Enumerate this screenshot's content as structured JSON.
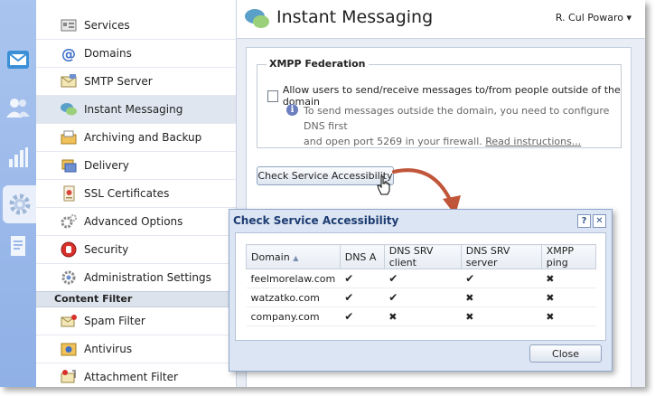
{
  "sidebar": {
    "items": [
      {
        "label": "Services",
        "icon": "services-icon"
      },
      {
        "label": "Domains",
        "icon": "at-sign-icon"
      },
      {
        "label": "SMTP Server",
        "icon": "smtp-envelope-icon"
      },
      {
        "label": "Instant Messaging",
        "icon": "chat-bubbles-icon"
      },
      {
        "label": "Archiving and Backup",
        "icon": "archive-icon"
      },
      {
        "label": "Delivery",
        "icon": "delivery-icon"
      },
      {
        "label": "SSL Certificates",
        "icon": "certificate-icon"
      },
      {
        "label": "Advanced Options",
        "icon": "gears-icon"
      },
      {
        "label": "Security",
        "icon": "stop-hand-icon"
      },
      {
        "label": "Administration Settings",
        "icon": "admin-settings-icon"
      }
    ],
    "group_label": "Content Filter",
    "filter_items": [
      {
        "label": "Spam Filter",
        "icon": "spam-filter-icon"
      },
      {
        "label": "Antivirus",
        "icon": "antivirus-icon"
      },
      {
        "label": "Attachment Filter",
        "icon": "attachment-filter-icon"
      }
    ]
  },
  "header": {
    "title": "Instant Messaging",
    "user": "R. Cul Powaro ▾"
  },
  "xmpp": {
    "legend": "XMPP Federation",
    "checkbox_label": "Allow users to send/receive messages to/from people outside of the domain",
    "checked": false,
    "info_line1": "To send messages outside the domain, you need to configure DNS first",
    "info_line2": "and open port 5269 in your firewall.",
    "info_link": "Read instructions..."
  },
  "check_button": "Check Service Accessibility",
  "dialog": {
    "title": "Check Service Accessibility",
    "help": "?",
    "close_x": "✕",
    "columns": [
      "Domain",
      "DNS A",
      "DNS SRV client",
      "DNS SRV server",
      "XMPP ping"
    ],
    "sort_indicator": "▲",
    "rows": [
      {
        "domain": "feelmorelaw.com",
        "dns_a": "✔",
        "srv_client": "✔",
        "srv_server": "✔",
        "xmpp_ping": "✖"
      },
      {
        "domain": "watzatko.com",
        "dns_a": "✔",
        "srv_client": "✔",
        "srv_server": "✖",
        "xmpp_ping": "✖"
      },
      {
        "domain": "company.com",
        "dns_a": "✔",
        "srv_client": "✖",
        "srv_server": "✖",
        "xmpp_ping": "✖"
      }
    ],
    "close_button": "Close"
  },
  "colors": {
    "rail": "#9db9ea",
    "selected_item": "#dfe6f0",
    "ok": "#3a9a2a",
    "fail": "#b0262a",
    "arrow": "#c0563a"
  }
}
